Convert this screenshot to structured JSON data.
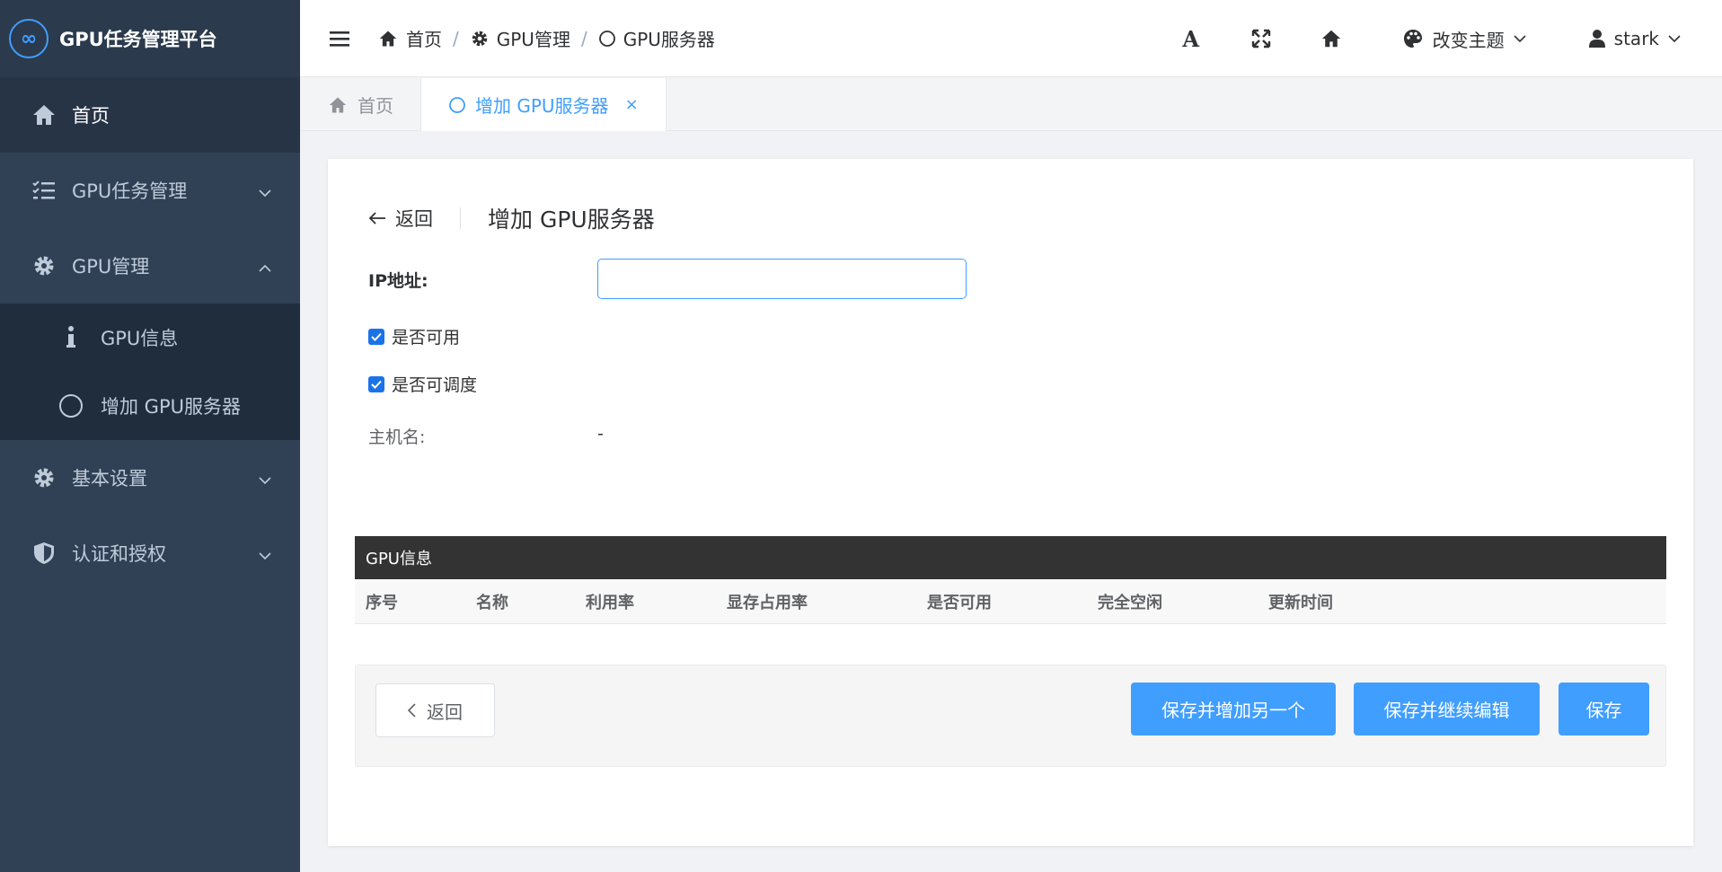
{
  "app": {
    "title": "GPU任务管理平台",
    "logo_glyph": "∞"
  },
  "sidebar": {
    "items": [
      {
        "label": "首页",
        "icon": "home-icon"
      },
      {
        "label": "GPU任务管理",
        "icon": "task-list-icon"
      },
      {
        "label": "GPU管理",
        "icon": "gear-icon"
      },
      {
        "label": "基本设置",
        "icon": "gear-icon"
      },
      {
        "label": "认证和授权",
        "icon": "shield-icon"
      }
    ],
    "subitems": [
      {
        "label": "GPU信息",
        "icon": "info-icon"
      },
      {
        "label": "增加 GPU服务器",
        "icon": "circle-icon"
      }
    ]
  },
  "header": {
    "breadcrumb": [
      {
        "label": "首页",
        "icon": "home-icon"
      },
      {
        "label": "GPU管理",
        "icon": "gear-icon"
      },
      {
        "label": "GPU服务器",
        "icon": "circle-icon"
      }
    ],
    "separator": "/",
    "font_tool": "A",
    "theme_label": "改变主题",
    "username": "stark"
  },
  "tabs": [
    {
      "label": "首页",
      "icon": "home-icon",
      "active": false
    },
    {
      "label": "增加 GPU服务器",
      "icon": "circle-icon",
      "active": true,
      "close": "×"
    }
  ],
  "page": {
    "back_label": "返回",
    "title": "增加 GPU服务器",
    "form": {
      "ip_label": "IP地址:",
      "ip_value": "",
      "available_label": "是否可用",
      "available_checked": true,
      "schedulable_label": "是否可调度",
      "schedulable_checked": true,
      "hostname_label": "主机名:",
      "hostname_value": "-"
    },
    "gpu_table": {
      "title": "GPU信息",
      "columns": [
        "序号",
        "名称",
        "利用率",
        "显存占用率",
        "是否可用",
        "完全空闲",
        "更新时间"
      ],
      "rows": []
    },
    "actions": {
      "back": "返回",
      "save_add_another": "保存并增加另一个",
      "save_continue": "保存并继续编辑",
      "save": "保存"
    }
  },
  "colors": {
    "sidebar_bg": "#304156",
    "primary": "#409eff",
    "table_header_bg": "#333333"
  }
}
